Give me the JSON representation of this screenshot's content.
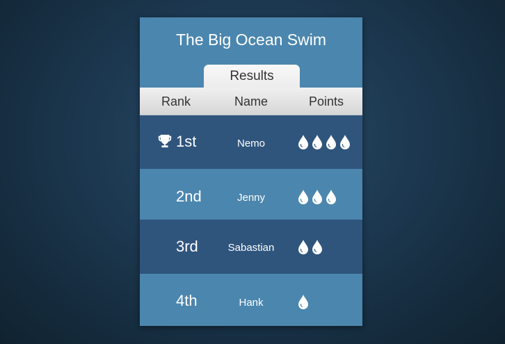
{
  "title": "The Big Ocean Swim",
  "tab": {
    "label": "Results"
  },
  "columns": {
    "rank": "Rank",
    "name": "Name",
    "points": "Points"
  },
  "rows": [
    {
      "rank": "1st",
      "name": "Nemo",
      "points": 4,
      "trophy": true
    },
    {
      "rank": "2nd",
      "name": "Jenny",
      "points": 3,
      "trophy": false
    },
    {
      "rank": "3rd",
      "name": "Sabastian",
      "points": 2,
      "trophy": false
    },
    {
      "rank": "4th",
      "name": "Hank",
      "points": 1,
      "trophy": false
    }
  ],
  "icons": {
    "trophy": "trophy-icon",
    "points": "water-drop-icon"
  },
  "colors": {
    "card": "#4b86ae",
    "row_dark": "#2f557d",
    "row_light": "#4b86ae",
    "header": "#e6e6e6",
    "text_light": "#ffffff",
    "text_dark": "#333333"
  }
}
